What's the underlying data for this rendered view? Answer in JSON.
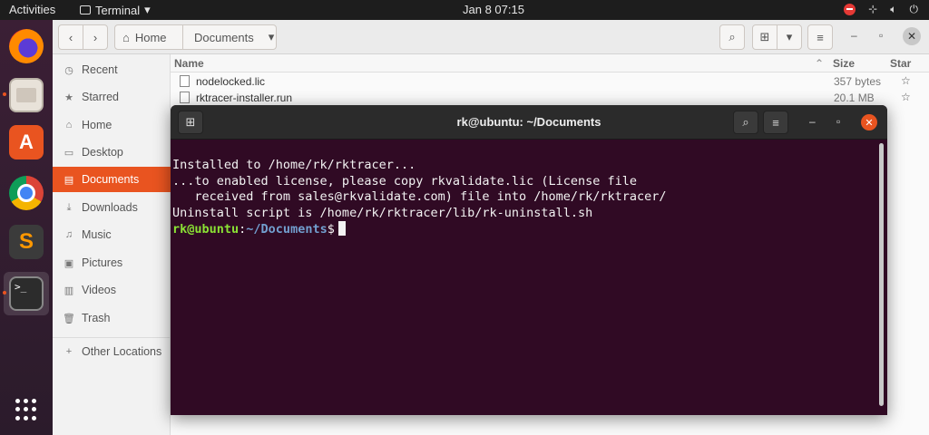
{
  "topbar": {
    "activities": "Activities",
    "app_name": "Terminal",
    "app_menu_arrow": "▾",
    "clock": "Jan 8  07:15"
  },
  "dock": {
    "apps": [
      "firefox-icon",
      "files-icon",
      "ubuntu-software-icon",
      "chrome-icon",
      "sublime-text-icon",
      "terminal-icon"
    ],
    "terminal_glyph": ">_",
    "software_glyph": "A",
    "sublime_glyph": "S"
  },
  "files": {
    "path": {
      "home": "Home",
      "current": "Documents"
    },
    "sidebar": [
      {
        "label": "Recent",
        "icon": "clock-icon"
      },
      {
        "label": "Starred",
        "icon": "star-icon"
      },
      {
        "label": "Home",
        "icon": "home-icon"
      },
      {
        "label": "Desktop",
        "icon": "desktop-icon"
      },
      {
        "label": "Documents",
        "icon": "document-icon",
        "active": true
      },
      {
        "label": "Downloads",
        "icon": "download-icon"
      },
      {
        "label": "Music",
        "icon": "music-icon"
      },
      {
        "label": "Pictures",
        "icon": "picture-icon"
      },
      {
        "label": "Videos",
        "icon": "video-icon"
      },
      {
        "label": "Trash",
        "icon": "trash-icon"
      },
      {
        "label": "Other Locations",
        "icon": "plus-icon"
      }
    ],
    "columns": {
      "name": "Name",
      "size": "Size",
      "star": "Star"
    },
    "rows": [
      {
        "name": "nodelocked.lic",
        "size": "357 bytes"
      },
      {
        "name": "rktracer-installer.run",
        "size": "20.1 MB"
      }
    ]
  },
  "terminal": {
    "title": "rk@ubuntu: ~/Documents",
    "lines": [
      "Installed to /home/rk/rktracer...",
      "...to enabled license, please copy rkvalidate.lic (License file",
      "   received from sales@rkvalidate.com) file into /home/rk/rktracer/",
      "Uninstall script is /home/rk/rktracer/lib/rk-uninstall.sh"
    ],
    "prompt_user": "rk@ubuntu",
    "prompt_sep": ":",
    "prompt_path": "~/Documents",
    "prompt_symbol": "$"
  },
  "colors": {
    "accent": "#e95420",
    "terminal_bg": "#300a24",
    "prompt_user": "#8ae234",
    "prompt_path": "#729fcf"
  }
}
